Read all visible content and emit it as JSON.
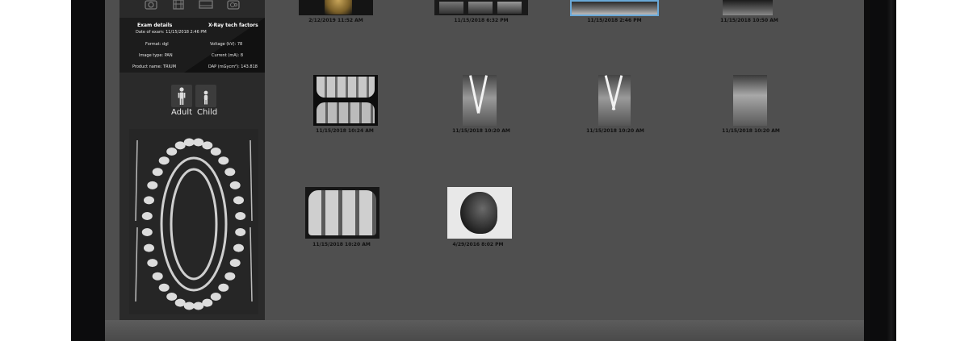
{
  "exam_details": {
    "title": "Exam details",
    "date_label": "Date of exam:",
    "date_value": "11/15/2018 2:46 PM",
    "format_label": "Format:",
    "format_value": "dgl",
    "image_type_label": "Image type:",
    "image_type_value": "PAN",
    "product_label": "Product name:",
    "product_value": "TRIUM"
  },
  "tech_factors": {
    "title": "X-Ray tech factors",
    "voltage_label": "Voltage (kV):",
    "voltage_value": "78",
    "current_label": "Current (mA):",
    "current_value": "8",
    "dap_label": "DAP (mGycm²):",
    "dap_value": "143.818"
  },
  "patient_type": {
    "adult_label": "Adult",
    "child_label": "Child"
  },
  "toolbar_icons": [
    "camera-icon",
    "film-icon",
    "video-icon",
    "cephalometric-icon"
  ],
  "thumbnails": [
    {
      "timestamp": "2/12/2019 11:52 AM",
      "kind": "3d-skull",
      "selected": false
    },
    {
      "timestamp": "11/15/2018 6:32 PM",
      "kind": "ct-slices",
      "selected": false
    },
    {
      "timestamp": "11/15/2018 2:46 PM",
      "kind": "panoramic",
      "selected": true
    },
    {
      "timestamp": "11/15/2018 10:50 AM",
      "kind": "panoramic-dark",
      "selected": false
    },
    {
      "timestamp": "11/15/2018 10:24 AM",
      "kind": "bitewing",
      "selected": false
    },
    {
      "timestamp": "11/15/2018 10:20 AM",
      "kind": "periapical-files",
      "selected": false
    },
    {
      "timestamp": "11/15/2018 10:20 AM",
      "kind": "periapical-files-2",
      "selected": false
    },
    {
      "timestamp": "11/15/2018 10:20 AM",
      "kind": "periapical",
      "selected": false
    },
    {
      "timestamp": "11/15/2018 10:20 AM",
      "kind": "molars-wide",
      "selected": false
    },
    {
      "timestamp": "4/29/2016 8:02 PM",
      "kind": "cephalometric",
      "selected": false
    }
  ],
  "colors": {
    "selection": "#6aa9d8",
    "panel_bg": "#2a2a2a",
    "main_bg": "#4f4f4f"
  }
}
